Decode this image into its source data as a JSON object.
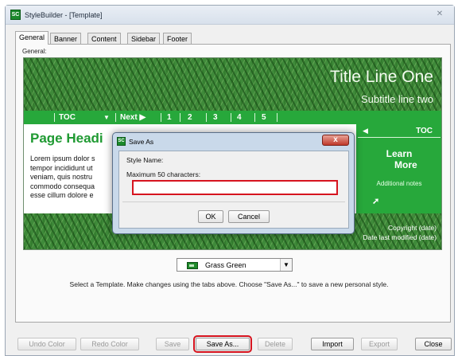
{
  "window": {
    "title": "StyleBuilder - [Template]",
    "logo_text": "SC",
    "close_glyph": "✕"
  },
  "tabs": [
    {
      "label": "General"
    },
    {
      "label": "Banner"
    },
    {
      "label": "Content"
    },
    {
      "label": "Sidebar"
    },
    {
      "label": "Footer"
    }
  ],
  "panel": {
    "label": "General:"
  },
  "preview": {
    "title": "Title Line One",
    "subtitle": "Subtitle line two",
    "nav": {
      "toc": "TOC",
      "down_arrow": "▼",
      "next": "Next ▶",
      "pages": [
        "1",
        "2",
        "3",
        "4",
        "5"
      ]
    },
    "page_heading": "Page Headi",
    "lorem": "Lorem ipsum dolor s\ntempor incididunt ut\nveniam, quis nostru\ncommodo consequa\nesse cillum dolore e",
    "sidebar": {
      "left_arrow": "◀",
      "toc": "TOC",
      "learn": "Learn",
      "more_arrow": "➚",
      "more": "More",
      "notes": "Additional notes"
    },
    "footer": {
      "copyright": "Copyright (date)",
      "modified": "Date last modified (date)"
    }
  },
  "template_select": {
    "value": "Grass Green",
    "arrow": "▼"
  },
  "instructions": "Select a Template. Make changes using the tabs above. Choose \"Save As...\" to save a new personal style.",
  "buttons": {
    "undo_color": "Undo Color",
    "redo_color": "Redo Color",
    "save": "Save",
    "save_as": "Save As...",
    "delete": "Delete",
    "import": "Import",
    "export": "Export",
    "close": "Close"
  },
  "dialog": {
    "title": "Save As",
    "logo_text": "SC",
    "close_glyph": "x",
    "style_name_label": "Style Name:",
    "max_label": "Maximum 50 characters:",
    "input_value": "",
    "ok": "OK",
    "cancel": "Cancel"
  },
  "colors": {
    "accent_green": "#27a83b",
    "heading_green": "#1f9a32",
    "highlight_red": "#d6141f"
  }
}
